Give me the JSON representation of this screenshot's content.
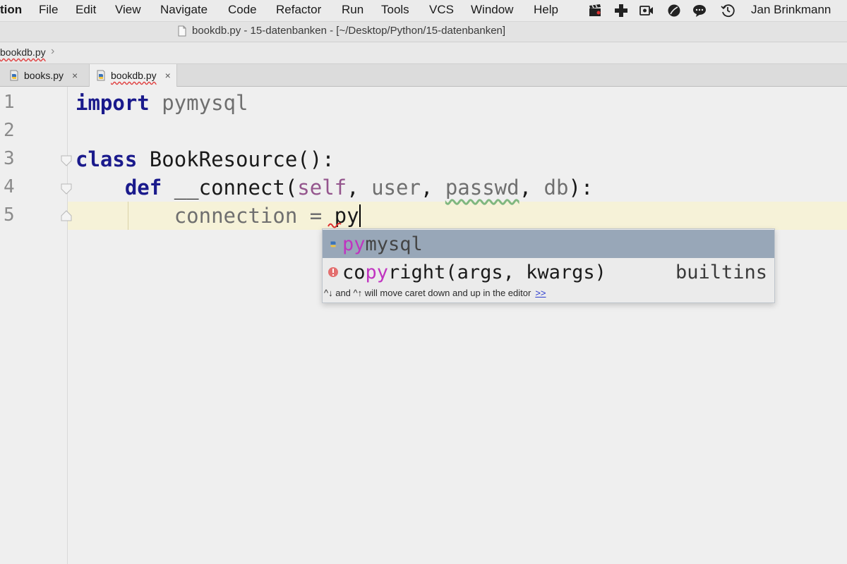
{
  "menubar": {
    "items": [
      "tion",
      "File",
      "Edit",
      "View",
      "Navigate",
      "Code",
      "Refactor",
      "Run",
      "Tools",
      "VCS",
      "Window",
      "Help"
    ],
    "user": "Jan Brinkmann"
  },
  "window": {
    "title": "bookdb.py - 15-datenbanken - [~/Desktop/Python/15-datenbanken]"
  },
  "navbar": {
    "breadcrumb": "bookdb.py"
  },
  "tabs": [
    {
      "label": "books.py",
      "close": "×"
    },
    {
      "label": "bookdb.py",
      "close": "×"
    }
  ],
  "editor": {
    "line_numbers": [
      "1",
      "2",
      "3",
      "4",
      "5"
    ],
    "lines": {
      "l1_kw": "import",
      "l1_mod": " pymysql",
      "l3_kw": "class",
      "l3_rest": " BookResource():",
      "l4_indent": "    ",
      "l4_kw": "def",
      "l4_name": " __connect(",
      "l4_self": "self",
      "l4_c1": ", ",
      "l4_user": "user",
      "l4_c2": ", ",
      "l4_passwd": "passwd",
      "l4_c3": ", ",
      "l4_db": "db",
      "l4_end": "):",
      "l5_indent": "        ",
      "l5_var": "connection = ",
      "l5_typed": "py"
    }
  },
  "autocomplete": {
    "items": [
      {
        "match": "py",
        "rest": "mysql",
        "type": ""
      },
      {
        "pre": "co",
        "match": "py",
        "rest": "right(args, kwargs)",
        "type": "builtins"
      }
    ],
    "hint": "^↓ and ^↑ will move caret down and up in the editor",
    "hint_link": ">>"
  }
}
